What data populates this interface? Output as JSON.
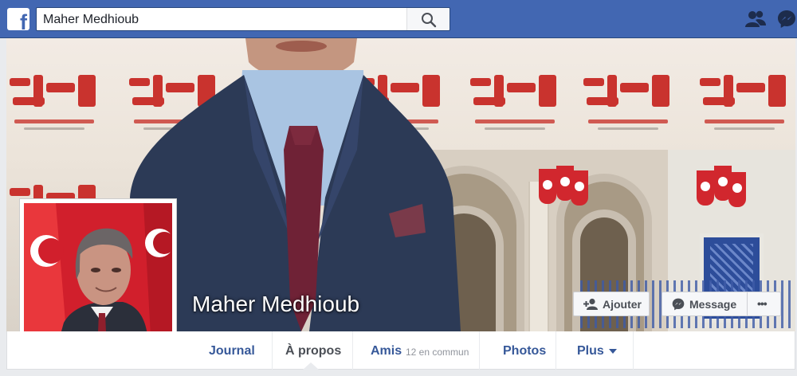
{
  "topbar": {
    "logo": "f",
    "search_value": "Maher Medhioub",
    "icons": [
      "friends-icon",
      "messenger-icon"
    ]
  },
  "profile": {
    "name": "Maher Medhioub"
  },
  "actions": {
    "add_friend_label": "Ajouter",
    "message_label": "Message",
    "more_label": "•••"
  },
  "tabs": [
    {
      "label": "Journal"
    },
    {
      "label": "À propos"
    },
    {
      "label": "Amis",
      "note": "12 en commun"
    },
    {
      "label": "Photos"
    },
    {
      "label": "Plus"
    }
  ],
  "colors": {
    "brand_blue": "#4267b2",
    "link_blue": "#365899",
    "tab_active": "#4b4f56"
  }
}
